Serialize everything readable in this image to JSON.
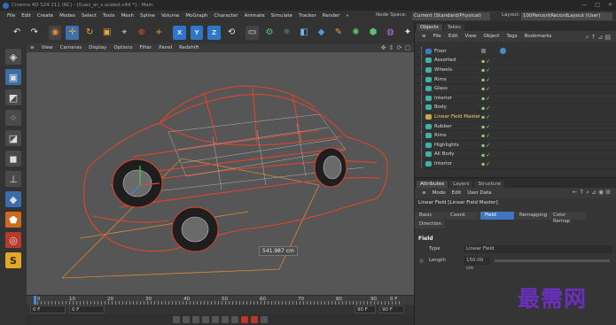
{
  "window": {
    "title": "Cinema 4D S24.111 (RC) - [0uez_ar_s.scaled.c4d *] - Main",
    "controls": [
      "—",
      "□",
      "✕"
    ]
  },
  "menubar": {
    "items": [
      "File",
      "Edit",
      "Create",
      "Modes",
      "Select",
      "Tools",
      "Mesh",
      "Spline",
      "Volume",
      "MoGraph",
      "Character",
      "Animate",
      "Simulate",
      "Tracker",
      "Render",
      "»"
    ],
    "node_space_label": "Node Space:",
    "node_space_value": "Current (Standard/Physical)",
    "layout_label": "Layout:",
    "layout_value": "100PercentRecordLayout (User)"
  },
  "toolbar": {
    "axis_x": "X",
    "axis_y": "Y",
    "axis_z": "Z"
  },
  "viewport": {
    "menu": [
      "≡",
      "View",
      "Cameras",
      "Display",
      "Options",
      "Filter",
      "Panel",
      "Redshift"
    ],
    "measure_label": "541.987 cm",
    "colors": {
      "wire": "#e0442c",
      "background": "#565656",
      "guide": "#d9883a"
    }
  },
  "timeline": {
    "ticks": [
      "0",
      "10",
      "20",
      "30",
      "40",
      "50",
      "60",
      "70",
      "80",
      "90"
    ],
    "end_frame": "0 F"
  },
  "framebar": {
    "start": "0 F",
    "current": "0 F",
    "end": "90 F",
    "max": "90 F"
  },
  "objects_panel": {
    "tabs": [
      "Objects",
      "Takes"
    ],
    "menu": [
      "≡",
      "File",
      "Edit",
      "View",
      "Object",
      "Tags",
      "Bookmarks"
    ],
    "items": [
      {
        "name": "Floor",
        "icon": "floor-icon"
      },
      {
        "name": "Assorted",
        "icon": "null-icon"
      },
      {
        "name": "Wheels",
        "icon": "null-icon"
      },
      {
        "name": "Rims",
        "icon": "null-icon"
      },
      {
        "name": "Glass",
        "icon": "null-icon"
      },
      {
        "name": "Interior",
        "icon": "null-icon"
      },
      {
        "name": "Body",
        "icon": "null-icon"
      },
      {
        "name": "Linear Field Master",
        "icon": "linear-field-icon"
      },
      {
        "name": "Rubber",
        "icon": "null-icon"
      },
      {
        "name": "Rims",
        "icon": "null-icon"
      },
      {
        "name": "Highlights",
        "icon": "null-icon"
      },
      {
        "name": "All Body",
        "icon": "null-icon"
      },
      {
        "name": "Interior",
        "icon": "null-icon"
      }
    ]
  },
  "attributes_panel": {
    "tabs": [
      "Attributes",
      "Layers",
      "Structure"
    ],
    "menu": [
      "≡",
      "Mode",
      "Edit",
      "User Data"
    ],
    "object_label": "Linear Field [Linear Field Master]",
    "sub_tabs": [
      "Basic",
      "Coord.",
      "Field",
      "Remapping",
      "Color Remap",
      "Direction"
    ],
    "section": "Field",
    "type_label": "Type",
    "type_value": "Linear Field",
    "length_label": "Length",
    "length_value": "150.00 cm"
  },
  "watermark": "最需网"
}
